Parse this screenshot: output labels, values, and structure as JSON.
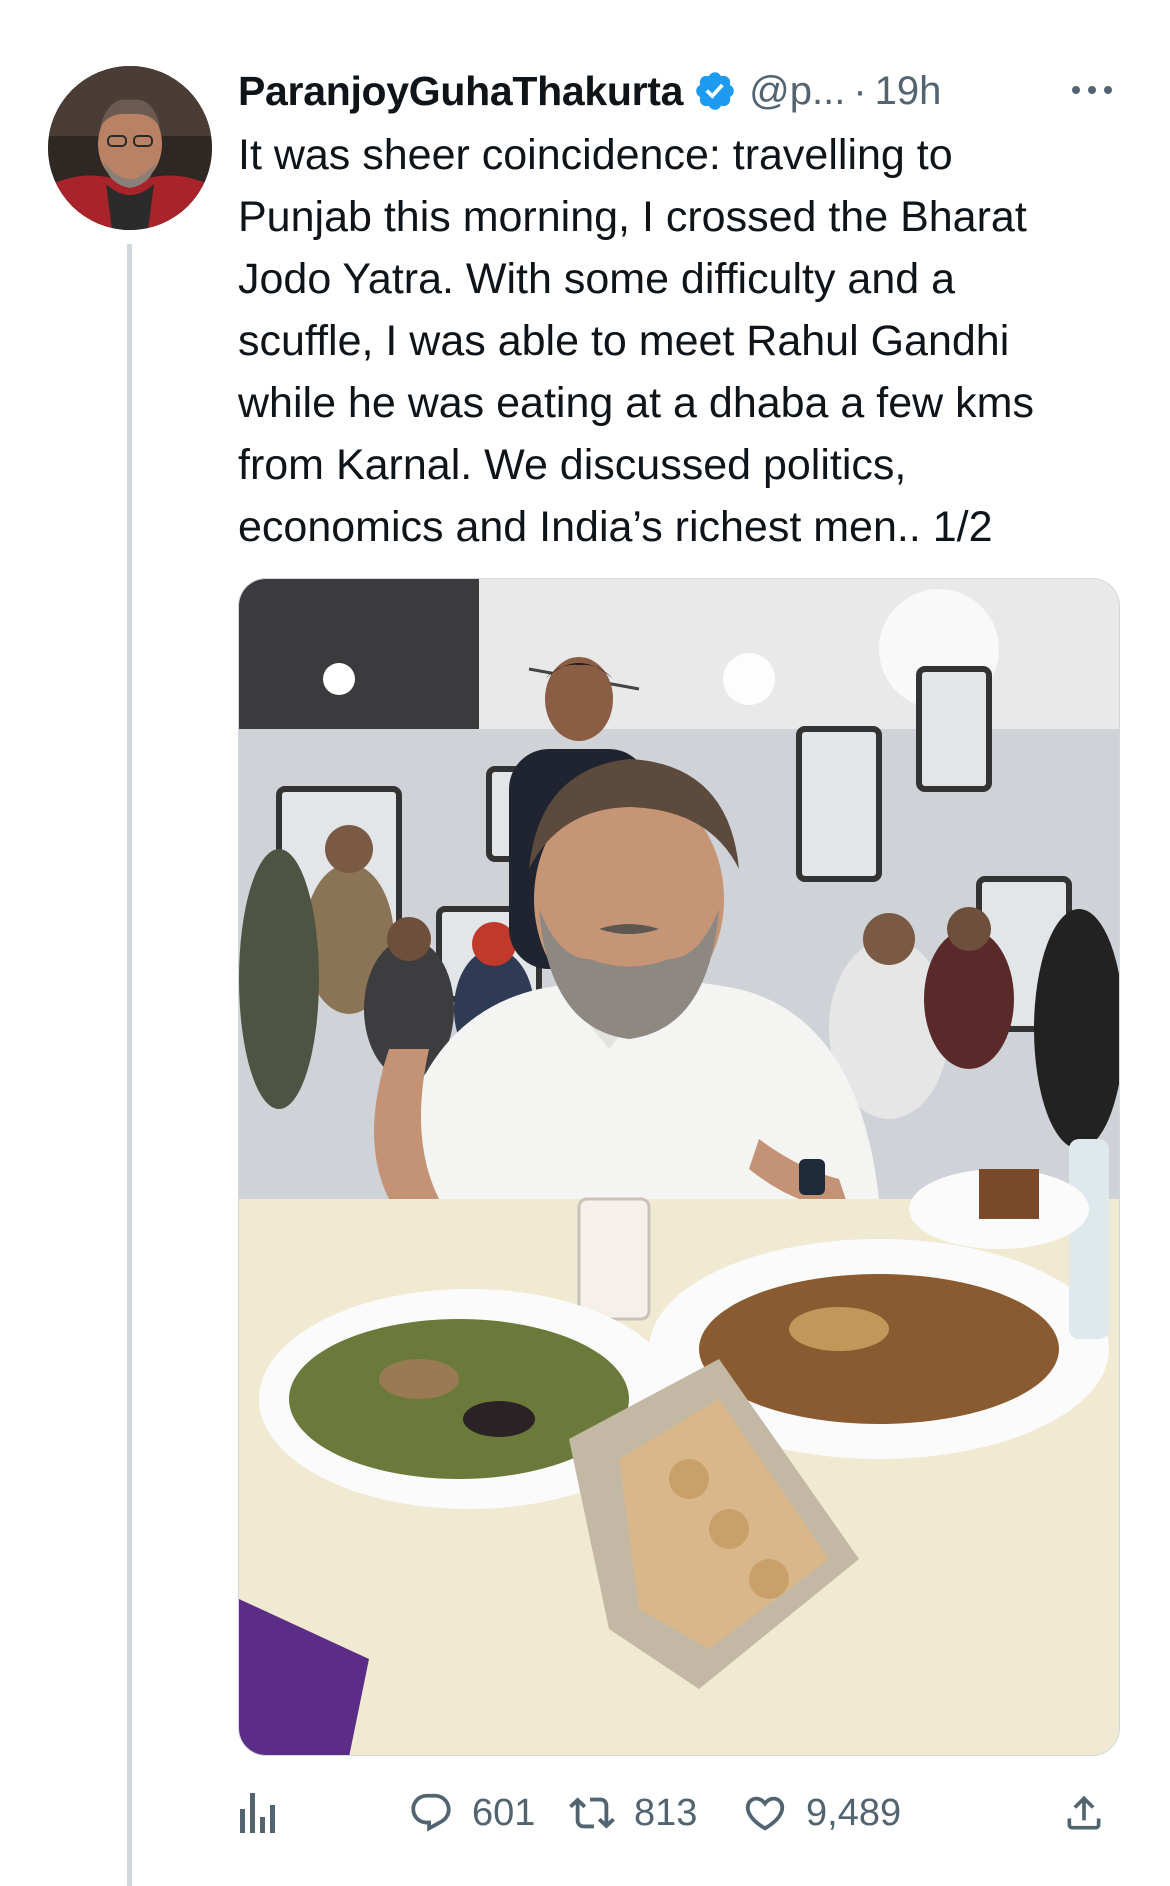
{
  "tweet": {
    "author": {
      "display_name": "ParanjoyGuhaThakurta",
      "handle": "@p...",
      "verified": true
    },
    "separator": "·",
    "time": "19h",
    "text": "It was sheer coincidence: travelling to\nPunjab this morning, I crossed the Bharat\nJodo Yatra. With some difficulty and a\nscuffle, I was able to meet Rahul Gandhi\nwhile he was eating at a dhaba a few kms\nfrom Karnal. We discussed politics,\neconomics and India’s richest men.. 1/2",
    "actions": {
      "replies": "601",
      "retweets": "813",
      "likes": "9,489"
    }
  },
  "icons": {
    "verified": "verified-badge-icon",
    "more": "more-options-icon",
    "analytics": "analytics-bar-icon",
    "reply": "speech-bubble-icon",
    "retweet": "retweet-arrows-icon",
    "like": "heart-icon",
    "share": "share-upload-icon"
  },
  "colors": {
    "accent": "#1d9bf0",
    "text": "#0f1419",
    "muted": "#536471",
    "thread_line": "#cfd9de"
  }
}
